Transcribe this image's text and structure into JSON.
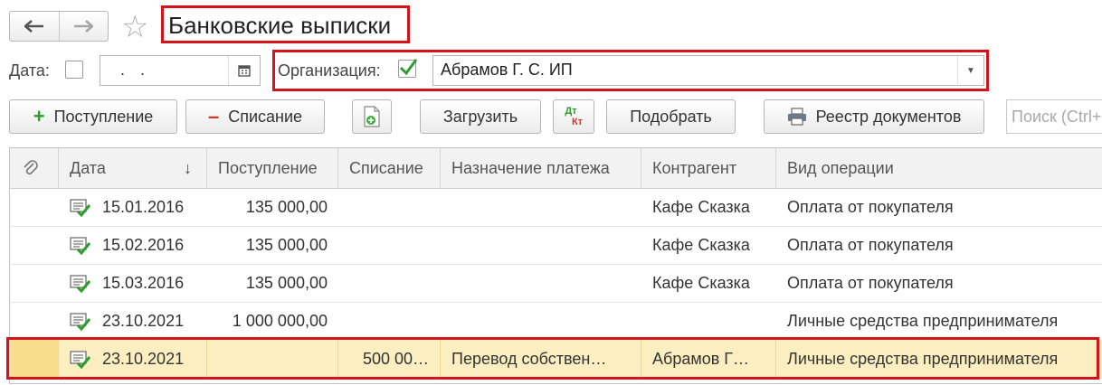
{
  "nav": {
    "back_icon": "arrow-left-icon",
    "forward_icon": "arrow-right-icon",
    "favorite_icon": "star-icon"
  },
  "title": "Банковские выписки",
  "filters": {
    "date_label": "Дата:",
    "date_value": ". .",
    "org_label": "Организация:",
    "org_value": "Абрамов Г. С. ИП"
  },
  "toolbar": {
    "income": "Поступление",
    "expense": "Списание",
    "load": "Загрузить",
    "dtkt_top": "Дт",
    "dtkt_bottom": "Кт",
    "pick": "Подобрать",
    "registry": "Реестр документов",
    "search_placeholder": "Поиск (Ctrl+F)"
  },
  "table": {
    "columns": [
      "Дата",
      "Поступление",
      "Списание",
      "Назначение платежа",
      "Контрагент",
      "Вид операции"
    ],
    "sort_arrow": "↓",
    "rows": [
      {
        "date": "15.01.2016",
        "income": "135 000,00",
        "expense": "",
        "purpose": "",
        "counterparty": "Кафе Сказка",
        "operation": "Оплата от покупателя"
      },
      {
        "date": "15.02.2016",
        "income": "135 000,00",
        "expense": "",
        "purpose": "",
        "counterparty": "Кафе Сказка",
        "operation": "Оплата от покупателя"
      },
      {
        "date": "15.03.2016",
        "income": "135 000,00",
        "expense": "",
        "purpose": "",
        "counterparty": "Кафе Сказка",
        "operation": "Оплата от покупателя"
      },
      {
        "date": "23.10.2021",
        "income": "1 000 000,00",
        "expense": "",
        "purpose": "",
        "counterparty": "",
        "operation": "Личные средства предпринимателя"
      },
      {
        "date": "23.10.2021",
        "income": "",
        "expense": "500 00…",
        "purpose": "Перевод собствен…",
        "counterparty": "Абрамов Г…",
        "operation": "Личные средства предпринимателя"
      }
    ]
  },
  "colors": {
    "highlight": "#d4141c",
    "selected_row": "#fbefc1",
    "check": "#2e9c2e"
  }
}
